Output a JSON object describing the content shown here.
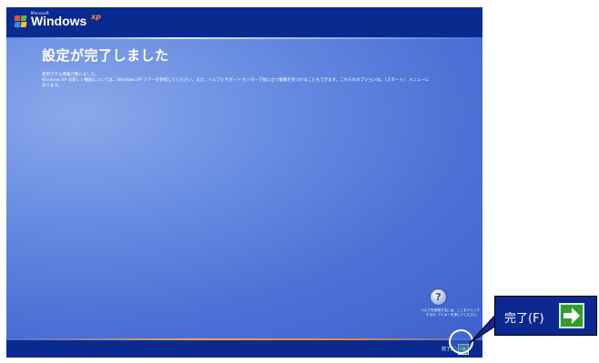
{
  "top_bar": {
    "brand_small": "Microsoft",
    "brand_name": "Windows",
    "brand_sup": "xp"
  },
  "main": {
    "title": "設定が完了しました",
    "body_lines": [
      "使用できる準備が整いました。",
      "Windows XP の新しい機能については、Windows XP ツアーを参照してください。また、ヘルプとサポート センターで役に立つ情報を見つけることもできます。これらのオプションは、［スタート］ メニューに",
      "あります。"
    ]
  },
  "help": {
    "icon": "help-question-icon",
    "text_line1": "ヘルプを参照するには、ここをクリック",
    "text_line2": "するか、F1 キーを押してください。"
  },
  "footer": {
    "finish_label": "完了(F)",
    "finish_icon": "right-arrow-icon"
  },
  "callout": {
    "label": "完了(F)",
    "icon": "right-arrow-icon"
  },
  "colors": {
    "bar_blue": "#0a2a8f",
    "content_blue": "#5a7edc",
    "accent_green": "#2f9e2f",
    "accent_orange": "#f08a3e"
  }
}
